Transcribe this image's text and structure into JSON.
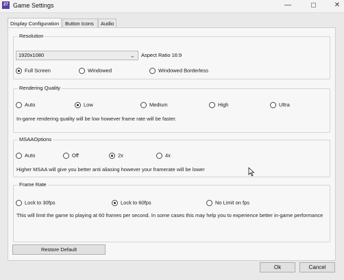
{
  "window": {
    "title": "Game Settings",
    "icon_text": "27"
  },
  "tabs": [
    {
      "label": "Display Configuration",
      "active": true
    },
    {
      "label": "Button Icons",
      "active": false
    },
    {
      "label": "Audio",
      "active": false
    }
  ],
  "resolution": {
    "title": "Resolution",
    "dropdown_value": "1920x1080",
    "aspect_label": "Aspect Ratio 16:9",
    "options": [
      {
        "label": "Full Screen",
        "selected": true
      },
      {
        "label": "Windowed",
        "selected": false
      },
      {
        "label": "Windowed Borderless",
        "selected": false
      }
    ]
  },
  "rendering_quality": {
    "title": "Rendering Quality",
    "options": [
      {
        "label": "Auto",
        "selected": false
      },
      {
        "label": "Low",
        "selected": true
      },
      {
        "label": "Medium",
        "selected": false
      },
      {
        "label": "High",
        "selected": false
      },
      {
        "label": "Ultra",
        "selected": false
      }
    ],
    "description": "In-game rendering quality will be low however frame rate will be faster."
  },
  "msaa": {
    "title": "MSAAOptions",
    "options": [
      {
        "label": "Auto",
        "selected": false
      },
      {
        "label": "Off",
        "selected": false
      },
      {
        "label": "2x",
        "selected": true
      },
      {
        "label": "4x",
        "selected": false
      }
    ],
    "description": "Higher MSAA will give you better anti aliasing however your framerate will be lower"
  },
  "frame_rate": {
    "title": "Frame Rate",
    "options": [
      {
        "label": "Lock  to 30fps",
        "selected": false
      },
      {
        "label": "Lock to 60fps",
        "selected": true
      },
      {
        "label": "No Limit on fps",
        "selected": false
      }
    ],
    "description": "This will limit the game to playing at 60 frames per second. In some cases this may help you to experience better in-game performance"
  },
  "buttons": {
    "restore": "Restore Default",
    "ok": "Ok",
    "cancel": "Cancel"
  },
  "icons": {
    "minimize": "minimize-icon",
    "maximize": "maximize-icon",
    "close": "close-icon",
    "dropdown": "chevron-down-icon"
  }
}
